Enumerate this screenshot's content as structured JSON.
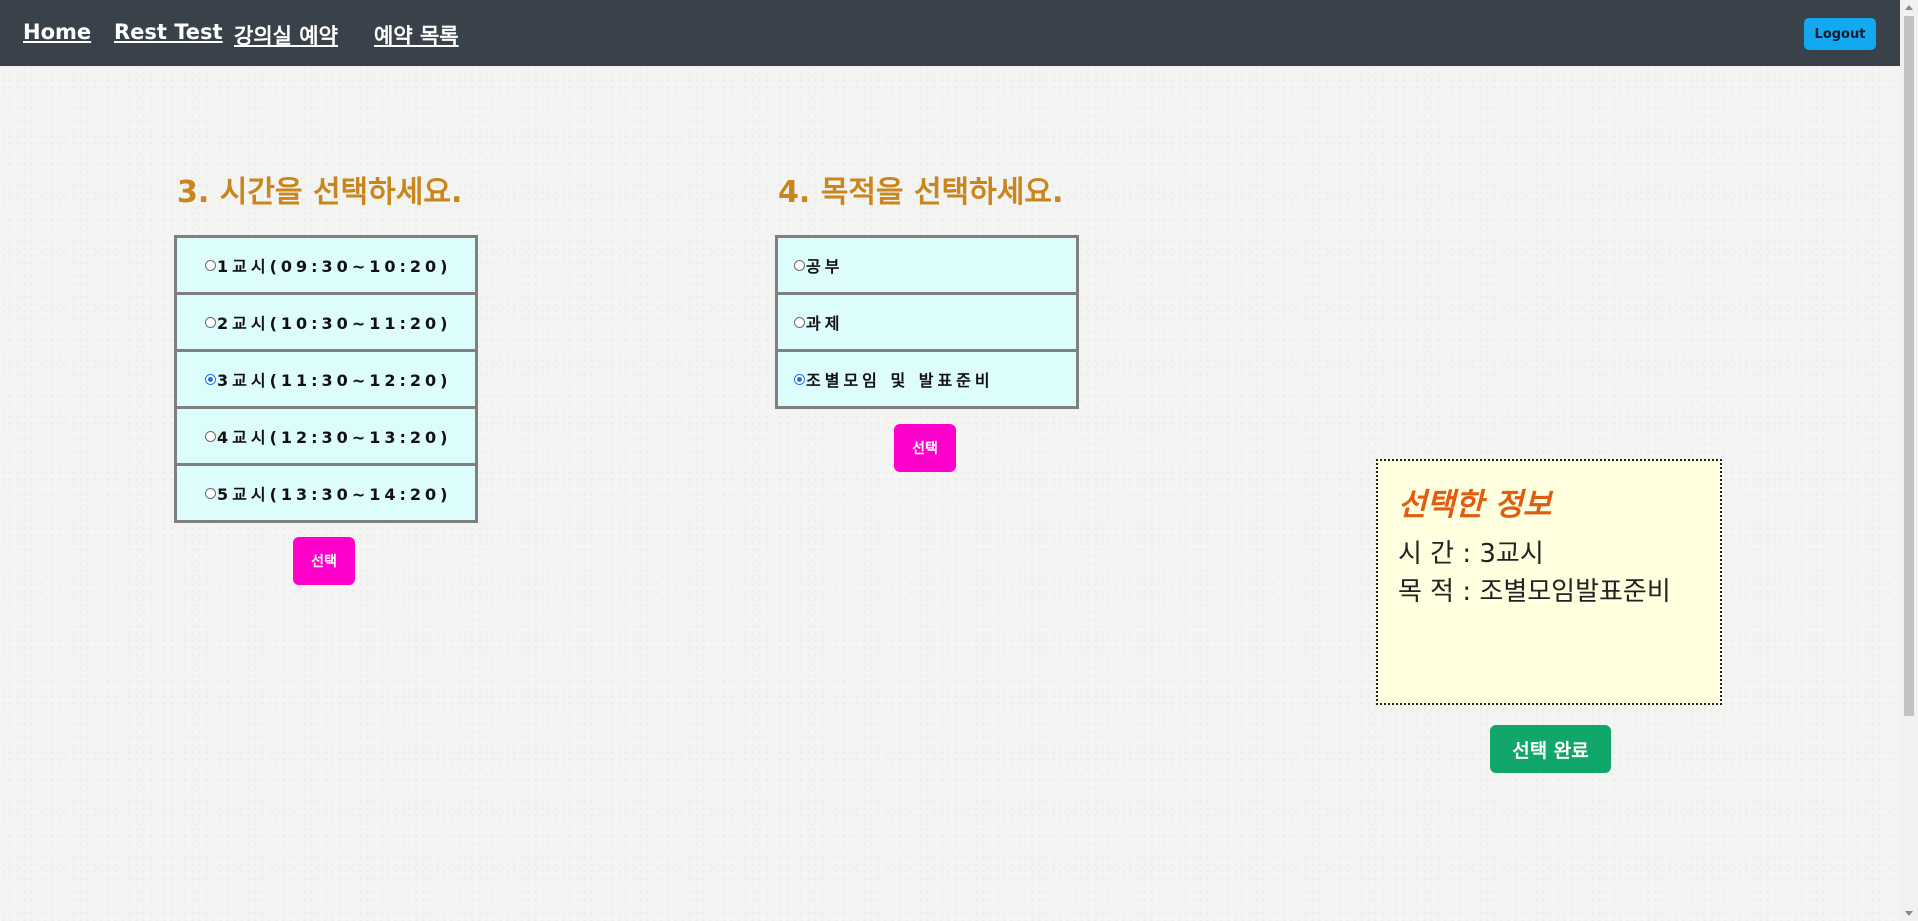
{
  "nav": {
    "links": [
      "Home",
      "Rest Test",
      "강의실 예약",
      "예약 목록"
    ],
    "logout": "Logout"
  },
  "time_section": {
    "heading": "3. 시간을 선택하세요.",
    "options": [
      {
        "label": "1교시(09:30~10:20)",
        "selected": false
      },
      {
        "label": "2교시(10:30~11:20)",
        "selected": false
      },
      {
        "label": "3교시(11:30~12:20)",
        "selected": true
      },
      {
        "label": "4교시(12:30~13:20)",
        "selected": false
      },
      {
        "label": "5교시(13:30~14:20)",
        "selected": false
      }
    ],
    "button": "선택"
  },
  "purpose_section": {
    "heading": "4. 목적을 선택하세요.",
    "options": [
      {
        "label": "공부",
        "selected": false
      },
      {
        "label": "과제",
        "selected": false
      },
      {
        "label": "조별모임 및 발표준비",
        "selected": true
      }
    ],
    "button": "선택"
  },
  "info": {
    "title": "선택한 정보",
    "time_line": "시 간 : 3교시",
    "purpose_line": "목 적 : 조별모임발표준비"
  },
  "done_button": "선택 완료",
  "colors": {
    "navbar": "#39424b",
    "heading": "#c9861c",
    "option_bg": "#dcfdfb",
    "select_button": "#ff00cc",
    "done_button": "#12a76a",
    "logout_button": "#12a9f0",
    "info_bg": "#ffffdf",
    "info_title": "#e05c10"
  }
}
